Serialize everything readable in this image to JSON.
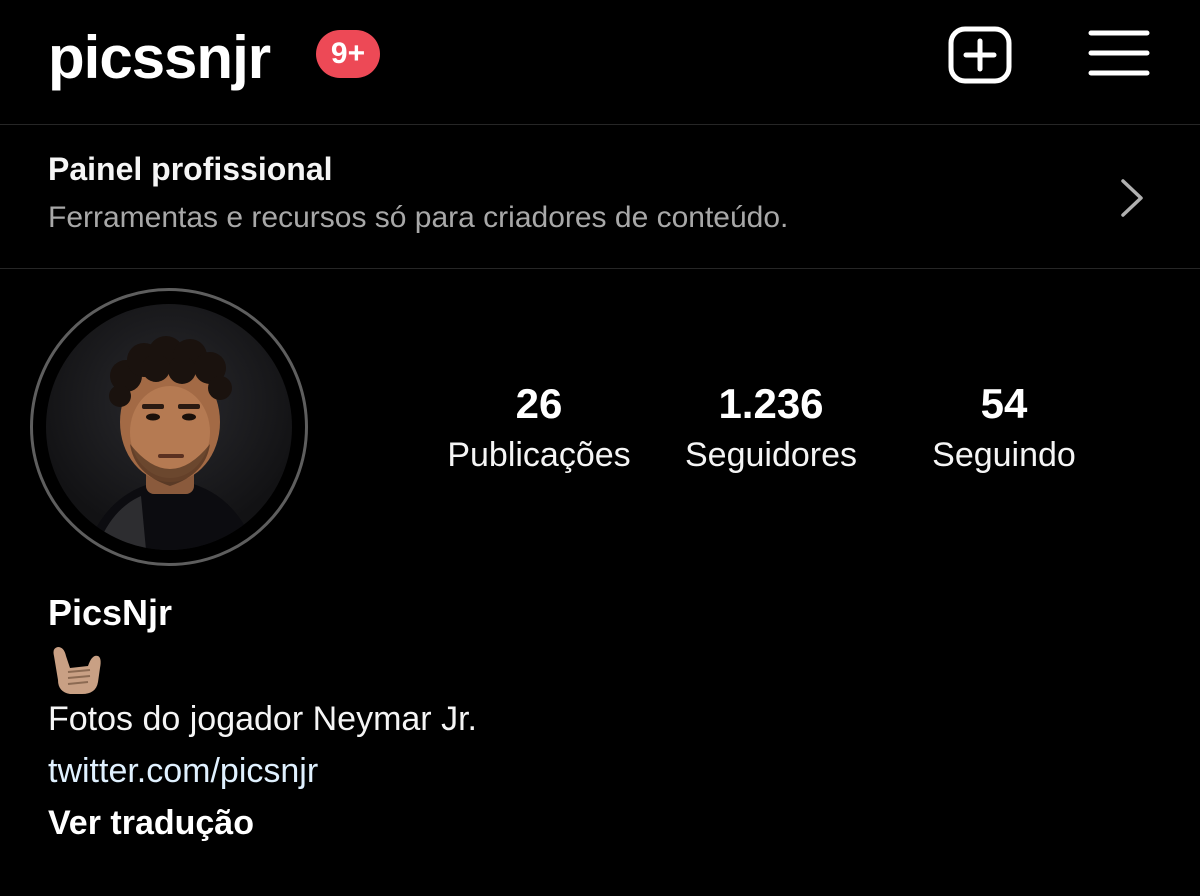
{
  "header": {
    "username": "picssnjr",
    "notification_badge": "9+",
    "new_post_icon": "plus-square-icon",
    "menu_icon": "hamburger-menu-icon"
  },
  "professional_dashboard": {
    "title": "Painel profissional",
    "subtitle": "Ferramentas e recursos só para criadores de conteúdo.",
    "chevron_icon": "chevron-right-icon"
  },
  "profile": {
    "avatar_icon": "profile-photo",
    "stats": [
      {
        "value": "26",
        "label": "Publicações"
      },
      {
        "value": "1.236",
        "label": "Seguidores"
      },
      {
        "value": "54",
        "label": "Seguindo"
      }
    ],
    "display_name": "PicsNjr",
    "bio_emoji": "call-me-hand-emoji",
    "bio_text": "Fotos do jogador Neymar Jr.",
    "link": "twitter.com/picsnjr",
    "translate_label": "Ver tradução"
  },
  "colors": {
    "background": "#000000",
    "badge": "#ed4956",
    "secondary_text": "#a8a8a8",
    "link": "#e0f1ff",
    "divider": "#262626"
  }
}
